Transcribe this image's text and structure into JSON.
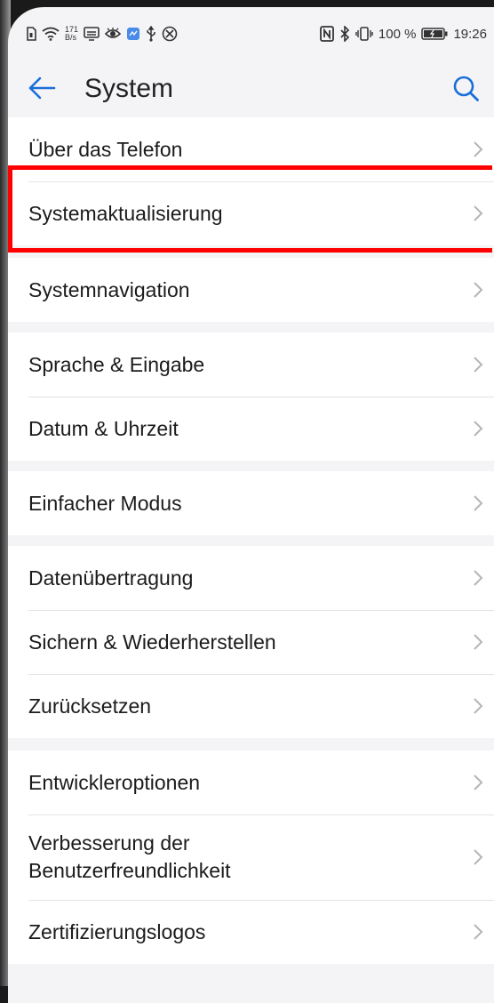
{
  "status_bar": {
    "net_speed_value": "171",
    "net_speed_unit": "B/s",
    "battery_percent": "100 %",
    "time": "19:26",
    "icons_left": [
      "sim-icon",
      "wifi-icon",
      "cast-icon",
      "eye-icon",
      "app-icon",
      "usb-icon",
      "blocked-icon"
    ],
    "icons_right": [
      "nfc-icon",
      "bluetooth-icon",
      "vibrate-icon",
      "battery-icon"
    ]
  },
  "header": {
    "title": "System",
    "back_icon": "arrow-left-icon",
    "search_icon": "search-icon",
    "accent_color": "#1a6fd8"
  },
  "groups": [
    {
      "items": [
        {
          "label": "Über das Telefon"
        },
        {
          "label": "Systemaktualisierung",
          "highlighted": true
        }
      ]
    },
    {
      "items": [
        {
          "label": "Systemnavigation"
        }
      ]
    },
    {
      "items": [
        {
          "label": "Sprache & Eingabe"
        },
        {
          "label": "Datum & Uhrzeit"
        }
      ]
    },
    {
      "items": [
        {
          "label": "Einfacher Modus"
        }
      ]
    },
    {
      "items": [
        {
          "label": "Datenübertragung"
        },
        {
          "label": "Sichern & Wiederherstellen"
        },
        {
          "label": "Zurücksetzen"
        }
      ]
    },
    {
      "items": [
        {
          "label": "Entwickleroptionen"
        },
        {
          "label": "Verbesserung der\nBenutzerfreundlichkeit"
        },
        {
          "label": "Zertifizierungslogos"
        }
      ]
    }
  ],
  "highlight_color": "#ff0000"
}
